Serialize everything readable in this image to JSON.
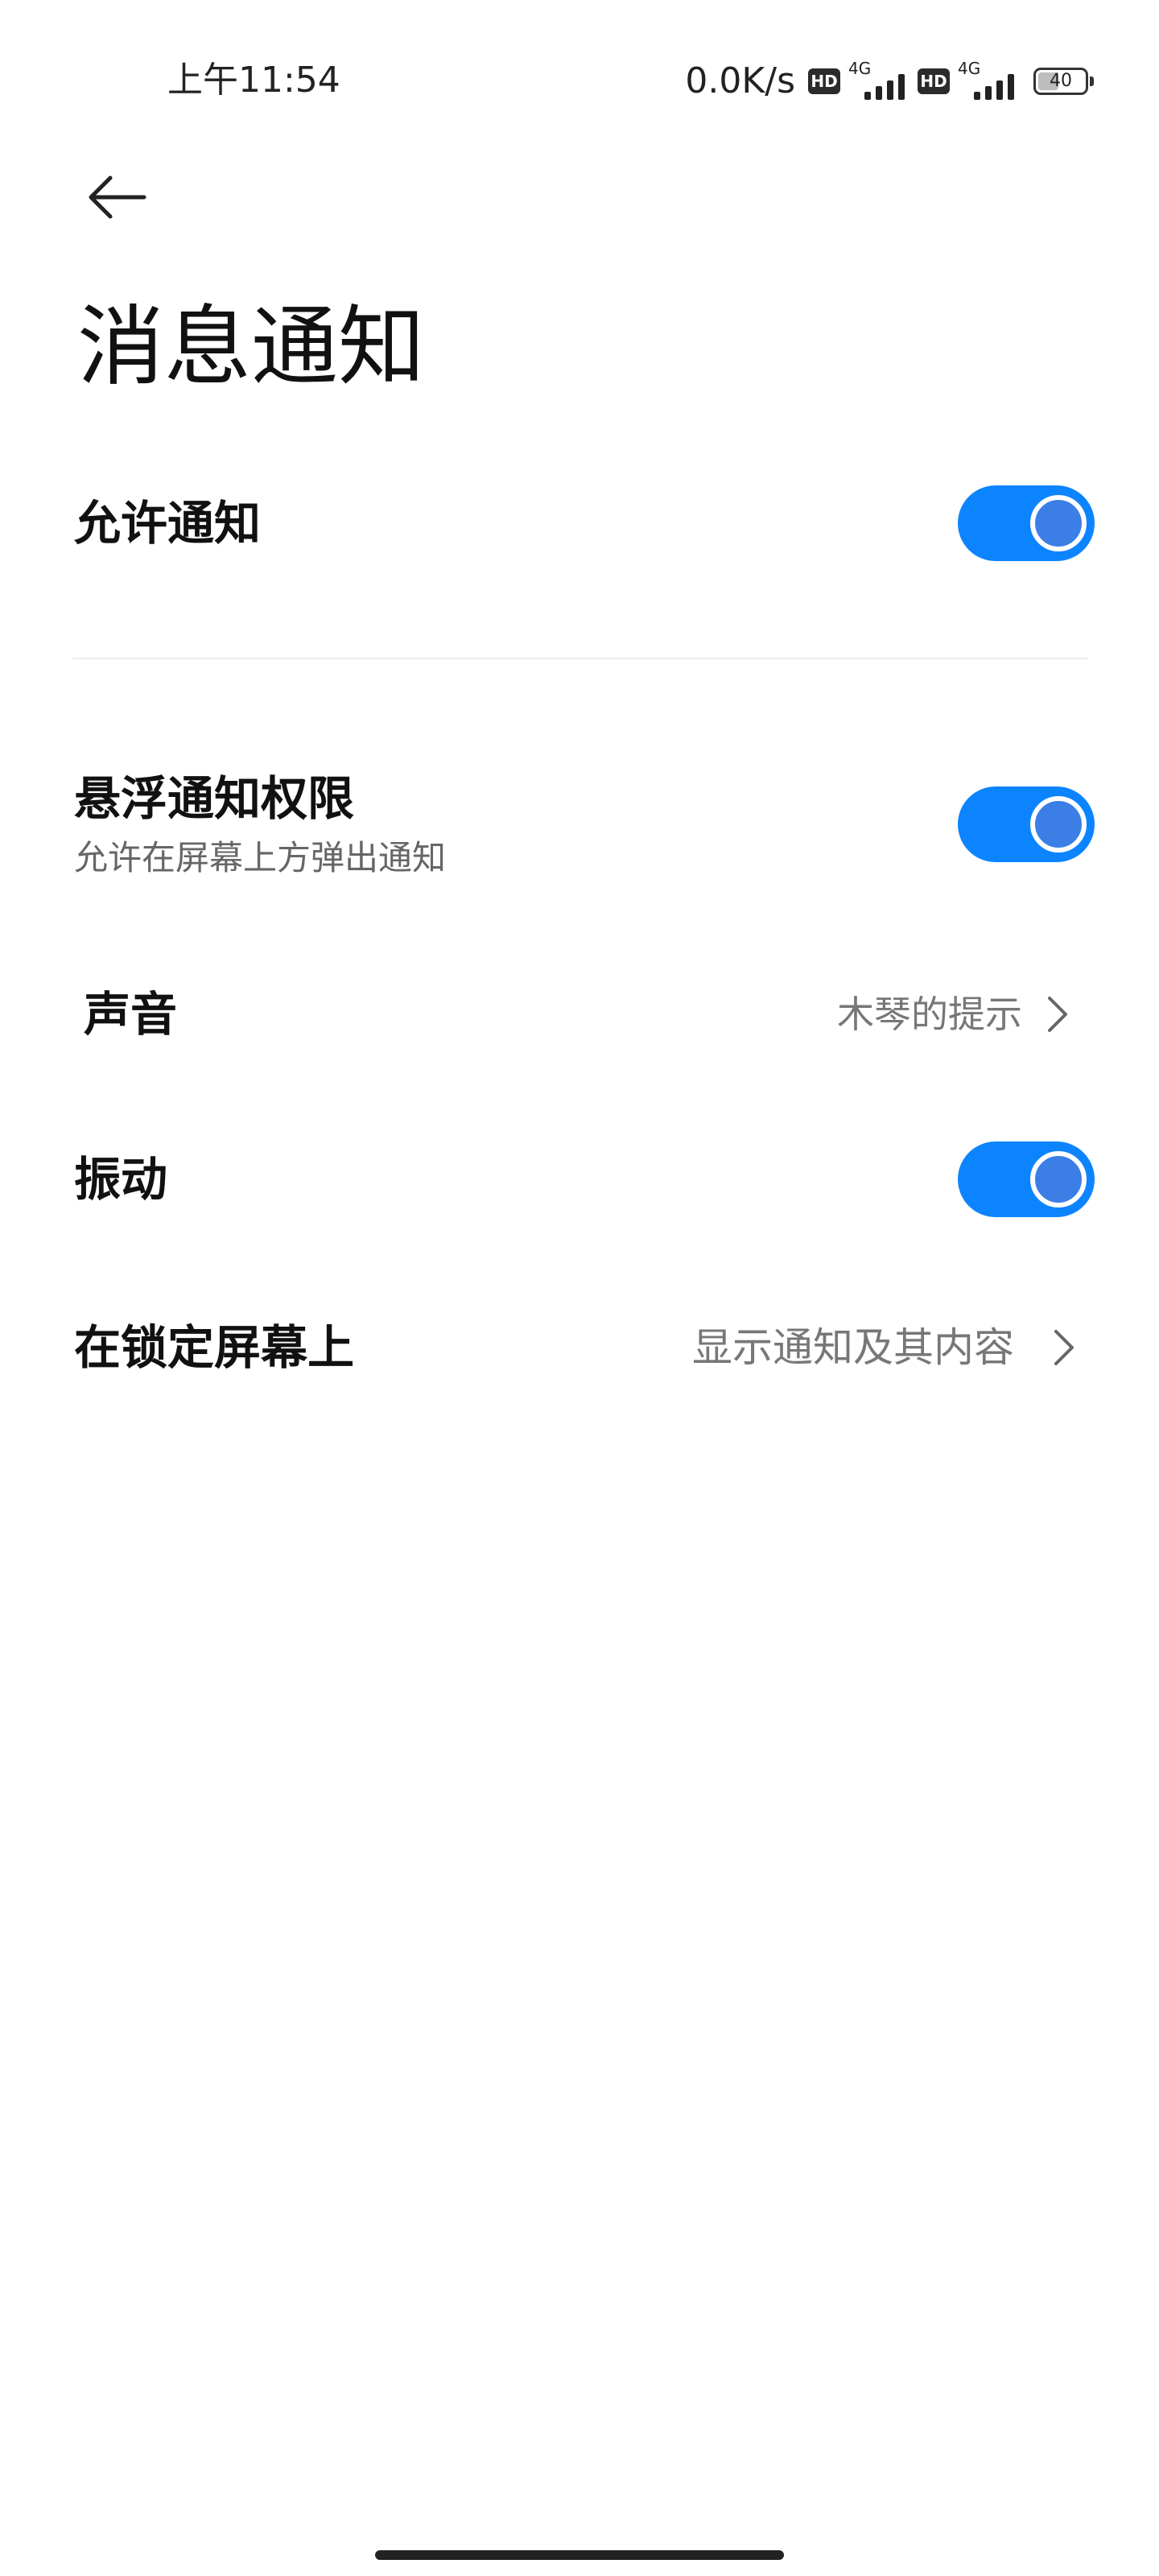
{
  "status_bar": {
    "time": "上午11:54",
    "net_speed": "0.0K/s",
    "hd_label": "HD",
    "network_type": "4G",
    "battery_level": "40",
    "battery_fraction": 0.4
  },
  "header": {
    "back_icon": "arrow-left-icon",
    "title": "消息通知"
  },
  "settings": {
    "allow_notifications": {
      "label": "允许通知",
      "enabled": true
    },
    "floating_notifications": {
      "label": "悬浮通知权限",
      "description": "允许在屏幕上方弹出通知",
      "enabled": true
    },
    "sound": {
      "label": "声音",
      "value": "木琴的提示"
    },
    "vibration": {
      "label": "振动",
      "enabled": true
    },
    "lock_screen": {
      "label": "在锁定屏幕上",
      "value": "显示通知及其内容"
    }
  },
  "colors": {
    "accent": "#0d84ff",
    "knob": "#3b7fe6",
    "secondary_text": "#777777"
  }
}
